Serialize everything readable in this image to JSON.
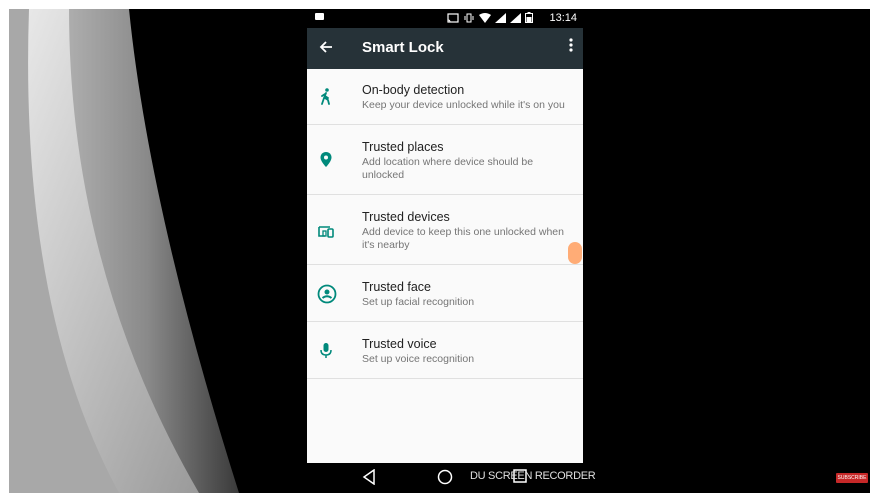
{
  "status_bar": {
    "time": "13:14"
  },
  "app_bar": {
    "title": "Smart Lock",
    "back_icon": "arrow-back-icon",
    "menu_icon": "more-vert-icon",
    "background": "#263238"
  },
  "accent_color": "#00897b",
  "items": [
    {
      "title": "On-body detection",
      "subtitle": "Keep your device unlocked while it's on you",
      "icon": "walking-person-icon"
    },
    {
      "title": "Trusted places",
      "subtitle": "Add location where device should be unlocked",
      "icon": "location-pin-icon"
    },
    {
      "title": "Trusted devices",
      "subtitle": "Add device to keep this one unlocked when it's nearby",
      "icon": "devices-icon"
    },
    {
      "title": "Trusted face",
      "subtitle": "Set up facial recognition",
      "icon": "face-icon"
    },
    {
      "title": "Trusted voice",
      "subtitle": "Set up voice recognition",
      "icon": "microphone-icon"
    }
  ],
  "nav_bar": {
    "icons": [
      "back-triangle-icon",
      "home-circle-icon",
      "recents-square-icon"
    ]
  },
  "watermark": "DU SCREEN RECORDER",
  "badge": "SUBSCRIBE"
}
